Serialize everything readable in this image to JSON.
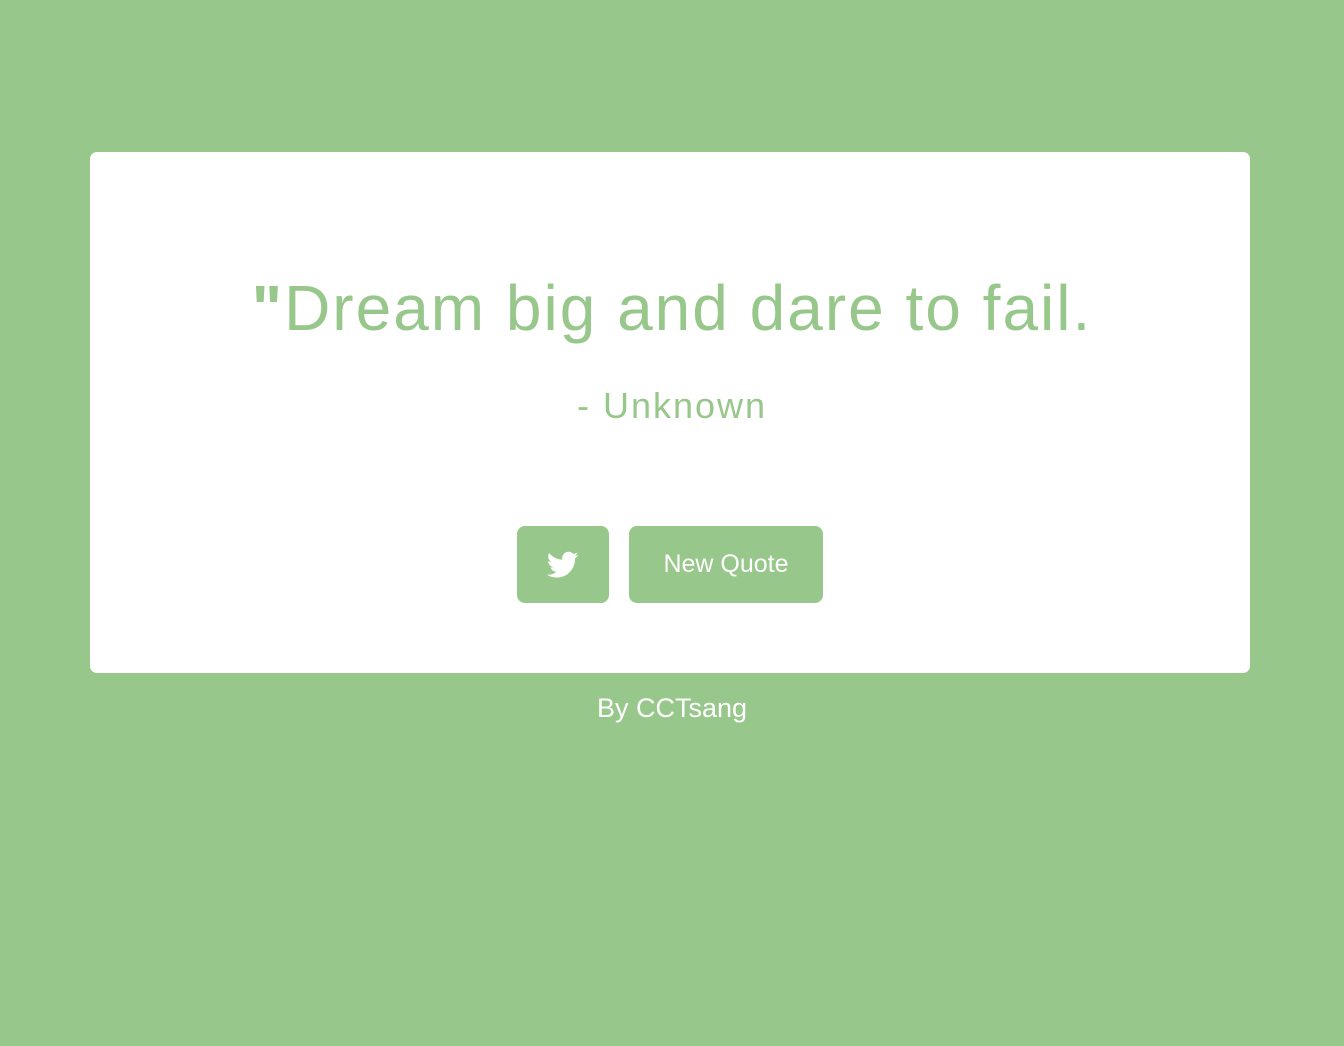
{
  "colors": {
    "background": "#97c78a",
    "card": "#ffffff",
    "accent": "#97c78a",
    "button_text": "#ffffff"
  },
  "quote": {
    "open_mark": "\"",
    "text": "Dream big and dare to fail.",
    "author": "- Unknown"
  },
  "actions": {
    "tweet_icon": "twitter-icon",
    "new_quote_label": "New Quote"
  },
  "footer": {
    "credit": "By CCTsang"
  }
}
